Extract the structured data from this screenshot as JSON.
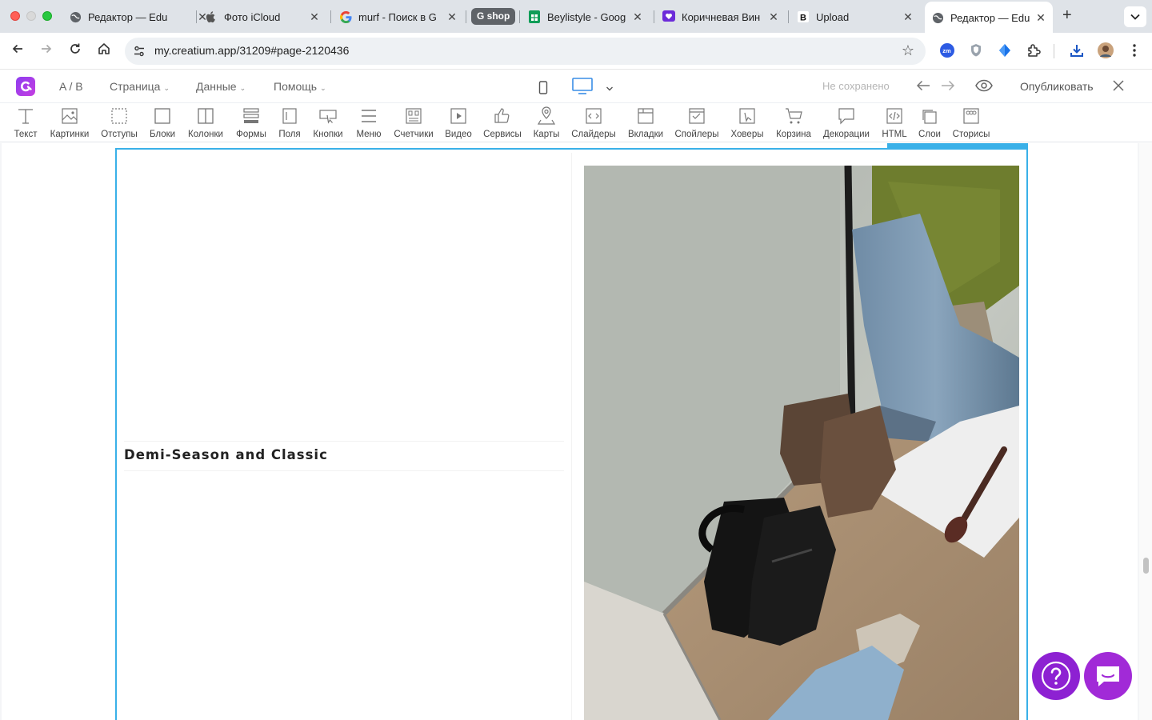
{
  "browser": {
    "tabs": [
      {
        "title": "Редактор — Edu",
        "icon": "globe-icon"
      },
      {
        "title": "Фото iCloud",
        "icon": "apple-icon"
      },
      {
        "title": "murf - Поиск в G",
        "icon": "google-icon"
      },
      {
        "title": "Beylistyle - Goog",
        "icon": "sheets-icon"
      },
      {
        "title": "Коричневая Вин",
        "icon": "heart-chat-icon"
      },
      {
        "title": "Upload",
        "icon": "b-icon"
      },
      {
        "title": "Редактор — Edu",
        "icon": "globe-icon",
        "active": true
      }
    ],
    "group_label": "G shop",
    "url": "my.creatium.app/31209#page-2120436"
  },
  "editor": {
    "ab_label": "A / B",
    "menu": [
      "Страница",
      "Данные",
      "Помощь"
    ],
    "status": "Не сохранено",
    "publish_label": "Опубликовать"
  },
  "toolbar": {
    "items": [
      "Текст",
      "Картинки",
      "Отступы",
      "Блоки",
      "Колонки",
      "Формы",
      "Поля",
      "Кнопки",
      "Меню",
      "Счетчики",
      "Видео",
      "Сервисы",
      "Карты",
      "Слайдеры",
      "Вкладки",
      "Спойлеры",
      "Ховеры",
      "Корзина",
      "Декорации",
      "HTML",
      "Слои",
      "Сторисы"
    ]
  },
  "content": {
    "heading": "Demi-Season and Classic",
    "photo_alt": "shoes-and-clothes-photo"
  },
  "colors": {
    "accent": "#8e3df0",
    "selection": "#39b0e8",
    "help": "#8d21d2"
  }
}
